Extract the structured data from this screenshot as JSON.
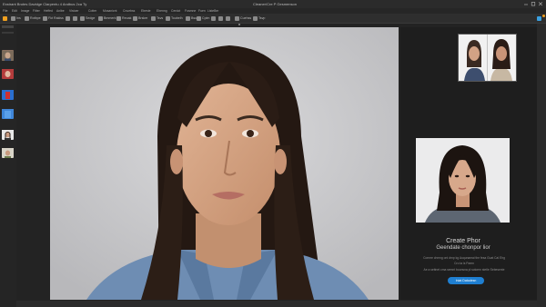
{
  "window": {
    "title": "Exstrant Brotes  Davidge   Clarpentu  4  Andbus 2ca  Ty",
    "document_title": "Cleaner/Cre P Gesmenson",
    "min_icon": "minimize-icon",
    "max_icon": "maximize-icon",
    "close_icon": "close-icon"
  },
  "menu": {
    "items": [
      "File",
      "Edit",
      "Image",
      "Fitter",
      "Heffed",
      "Anlbe",
      "Vistoer",
      "Cotter",
      "Mosanicnt",
      "Cnuebss",
      "Ebeste",
      "Ehenng",
      "Cerdot",
      "Fosmne",
      "Fuen",
      "ListeBer"
    ]
  },
  "toolbar": {
    "items": [
      {
        "label": "",
        "icon": "home-icon",
        "style": "orange"
      },
      {
        "label": "Ins",
        "icon": "move-icon"
      },
      {
        "label": "Rotbpe",
        "icon": "crop-icon"
      },
      {
        "label": "Fkt Rakiss",
        "icon": "lasso-icon"
      },
      {
        "label": "",
        "icon": "brush-icon"
      },
      {
        "label": "",
        "icon": "eraser-icon"
      },
      {
        "label": "Sedge",
        "icon": "text-icon"
      },
      {
        "label": "Bmmerk",
        "icon": "heal-icon"
      },
      {
        "label": "Reoak",
        "icon": "clone-icon"
      },
      {
        "label": "Brsker",
        "icon": "gradient-icon"
      },
      {
        "label": "Tsvs",
        "icon": "pen-icon"
      },
      {
        "label": "Toubelh",
        "icon": "shape-icon"
      },
      {
        "label": "Bsu",
        "icon": "hand-icon"
      },
      {
        "label": "Cplm",
        "icon": "zoom-icon"
      },
      {
        "label": "",
        "icon": "layers-icon"
      },
      {
        "label": "",
        "icon": "adjust-icon"
      },
      {
        "label": "",
        "icon": "mask-icon"
      },
      {
        "label": "Cuehss",
        "icon": "settings-icon"
      },
      {
        "label": "Tsvp",
        "icon": "export-icon"
      },
      {
        "label": "",
        "icon": "share-icon",
        "style": "blue"
      }
    ]
  },
  "colors": {
    "accent": "#1f7fd1",
    "orange": "#f0a020",
    "panel_bg": "#1e1e1e",
    "canvas_bg": "#232323"
  },
  "right_panel": {
    "caption_title": "Create Phor",
    "caption_subtitle": "Geendate chonpor lior",
    "description_lines": [
      "Cornee chmng ont drnp kg Auqunamai the fesa Guat Cal Ehg",
      "Cro ta ls Paem",
      "Ae a settnet cma semnt boonsna pl sotomn stetle Sebesente"
    ],
    "cta_label": "Iniat Datodesn"
  }
}
